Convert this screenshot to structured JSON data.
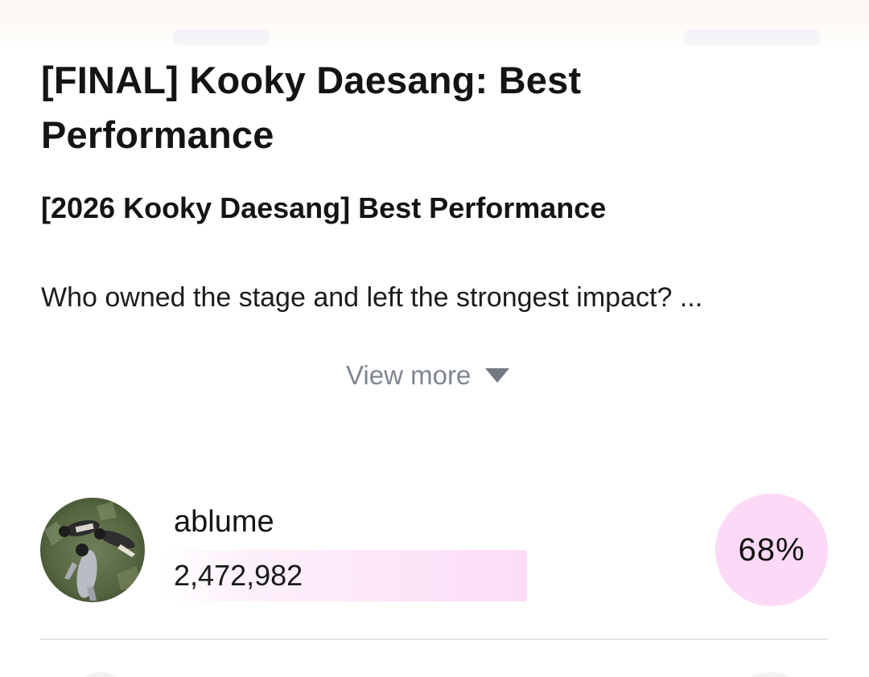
{
  "poll": {
    "title": "[FINAL] Kooky Daesang: Best Performance",
    "subtitle": "[2026 Kooky Daesang] Best Performance",
    "description": "Who owned the stage and left the strongest impact? ...",
    "view_more_label": "View more",
    "view_more_icon": "triangle-down-icon"
  },
  "ranking": [
    {
      "artist": "ablume",
      "votes": "2,472,982",
      "percent": "68%",
      "avatar": "artist-photo",
      "bar_fill": 0.68
    }
  ],
  "colors": {
    "bar_accent": "#fbdcf7",
    "badge_background": "#fcd9f6",
    "muted_text": "#7f8690"
  }
}
